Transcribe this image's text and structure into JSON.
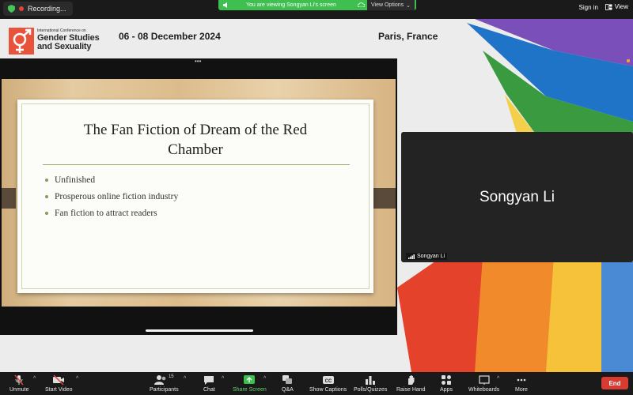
{
  "topbar": {
    "recording_label": "Recording...",
    "viewing_banner": "You are viewing Songyan Li's screen",
    "view_options_label": "View Options",
    "sign_in_label": "Sign in",
    "view_label": "View"
  },
  "conference": {
    "logo_small": "International Conference on",
    "logo_line1": "Gender Studies",
    "logo_line2": "and Sexuality",
    "dates": "06 - 08 December 2024",
    "location": "Paris, France",
    "accent_color": "#e8533b"
  },
  "slide": {
    "title_line1": "The Fan Fiction of Dream of the Red",
    "title_line2": "Chamber",
    "bullets": [
      "Unfinished",
      "Prosperous online fiction industry",
      "Fan fiction to attract readers"
    ]
  },
  "participant_tile": {
    "name": "Songyan Li",
    "label": "Songyan Li"
  },
  "toolbar": {
    "unmute": "Unmute",
    "start_video": "Start Video",
    "participants": "Participants",
    "participants_count": "15",
    "chat": "Chat",
    "share_screen": "Share Screen",
    "qa": "Q&A",
    "show_captions": "Show Captions",
    "polls": "Polls/Quizzes",
    "raise_hand": "Raise Hand",
    "apps": "Apps",
    "whiteboards": "Whiteboards",
    "more": "More",
    "end": "End",
    "share_color": "#3fbf4f",
    "end_color": "#d83b31"
  }
}
